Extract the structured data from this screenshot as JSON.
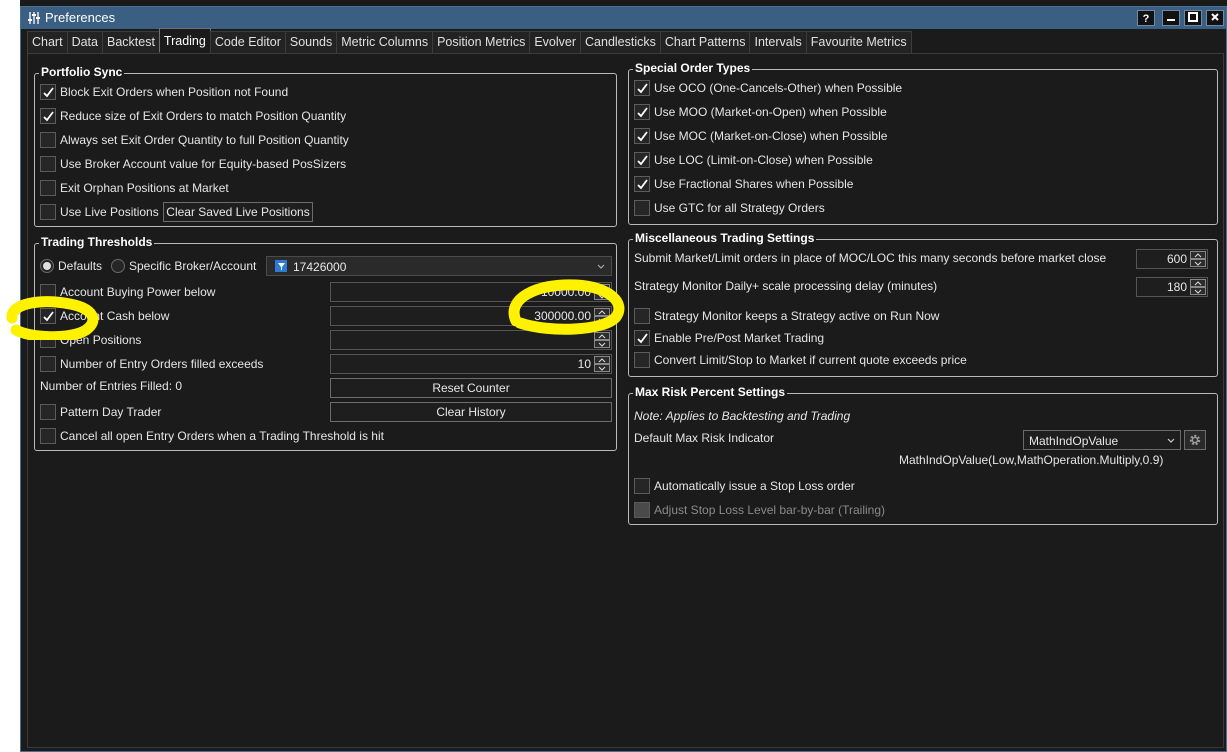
{
  "window": {
    "title": "Preferences",
    "help_label": "?"
  },
  "tabs": [
    "Chart",
    "Data",
    "Backtest",
    "Trading",
    "Code Editor",
    "Sounds",
    "Metric Columns",
    "Position Metrics",
    "Evolver",
    "Candlesticks",
    "Chart Patterns",
    "Intervals",
    "Favourite Metrics"
  ],
  "active_tab": "Trading",
  "portfolio_sync": {
    "title": "Portfolio Sync",
    "items": [
      {
        "label": "Block Exit Orders when Position not Found",
        "checked": true
      },
      {
        "label": "Reduce size of Exit Orders to match Position Quantity",
        "checked": true
      },
      {
        "label": "Always set Exit Order Quantity to full Position Quantity",
        "checked": false
      },
      {
        "label": "Use Broker Account value for Equity-based PosSizers",
        "checked": false
      },
      {
        "label": "Exit Orphan Positions at Market",
        "checked": false
      },
      {
        "label": "Use Live Positions",
        "checked": false
      }
    ],
    "clear_button": "Clear Saved Live Positions"
  },
  "trading_thresholds": {
    "title": "Trading Thresholds",
    "radio_defaults": "Defaults",
    "radio_specific": "Specific Broker/Account",
    "account": "17426000",
    "account_icon": "broker-logo-icon",
    "items": [
      {
        "label": "Account Buying Power below",
        "checked": false,
        "value": "10000.00"
      },
      {
        "label": "Account Cash below",
        "checked": true,
        "value": "300000.00"
      },
      {
        "label": "Open Positions",
        "checked": false,
        "value": ""
      },
      {
        "label": "Number of Entry Orders filled exceeds",
        "checked": false,
        "value": "10"
      }
    ],
    "entries_filled": "Number of Entries Filled: 0",
    "reset_button": "Reset Counter",
    "pattern_day_trader": "Pattern Day Trader",
    "clear_history_button": "Clear History",
    "cancel_all": "Cancel all open Entry Orders when a Trading Threshold is hit"
  },
  "special_order_types": {
    "title": "Special Order Types",
    "items": [
      {
        "label": "Use OCO (One-Cancels-Other) when Possible",
        "checked": true
      },
      {
        "label": "Use MOO (Market-on-Open) when Possible",
        "checked": true
      },
      {
        "label": "Use MOC (Market-on-Close) when Possible",
        "checked": true
      },
      {
        "label": "Use LOC (Limit-on-Close) when Possible",
        "checked": true
      },
      {
        "label": "Use Fractional Shares when Possible",
        "checked": true
      },
      {
        "label": "Use GTC for all Strategy Orders",
        "checked": false
      }
    ]
  },
  "misc_trading": {
    "title": "Miscellaneous Trading Settings",
    "submit_label": "Submit Market/Limit orders in place of MOC/LOC this many seconds before market close",
    "submit_value": "600",
    "delay_label": "Strategy Monitor Daily+ scale processing delay (minutes)",
    "delay_value": "180",
    "items": [
      {
        "label": "Strategy Monitor keeps a Strategy active on Run Now",
        "checked": false
      },
      {
        "label": "Enable Pre/Post Market Trading",
        "checked": true
      },
      {
        "label": "Convert Limit/Stop to Market if current quote exceeds price",
        "checked": false
      }
    ]
  },
  "max_risk": {
    "title": "Max Risk Percent Settings",
    "note": "Note: Applies to Backtesting and Trading",
    "indicator_label": "Default Max Risk Indicator",
    "indicator_value": "MathIndOpValue",
    "indicator_expression": "MathIndOpValue(Low,MathOperation.Multiply,0.9)",
    "auto_stop": {
      "label": "Automatically issue a Stop Loss order",
      "checked": false
    },
    "trailing": {
      "label": "Adjust Stop Loss Level bar-by-bar (Trailing)",
      "checked": false,
      "disabled": true
    }
  },
  "colors": {
    "titlebar": "#3a5f82",
    "background": "#1b1b1b",
    "highlight": "#fff200"
  }
}
